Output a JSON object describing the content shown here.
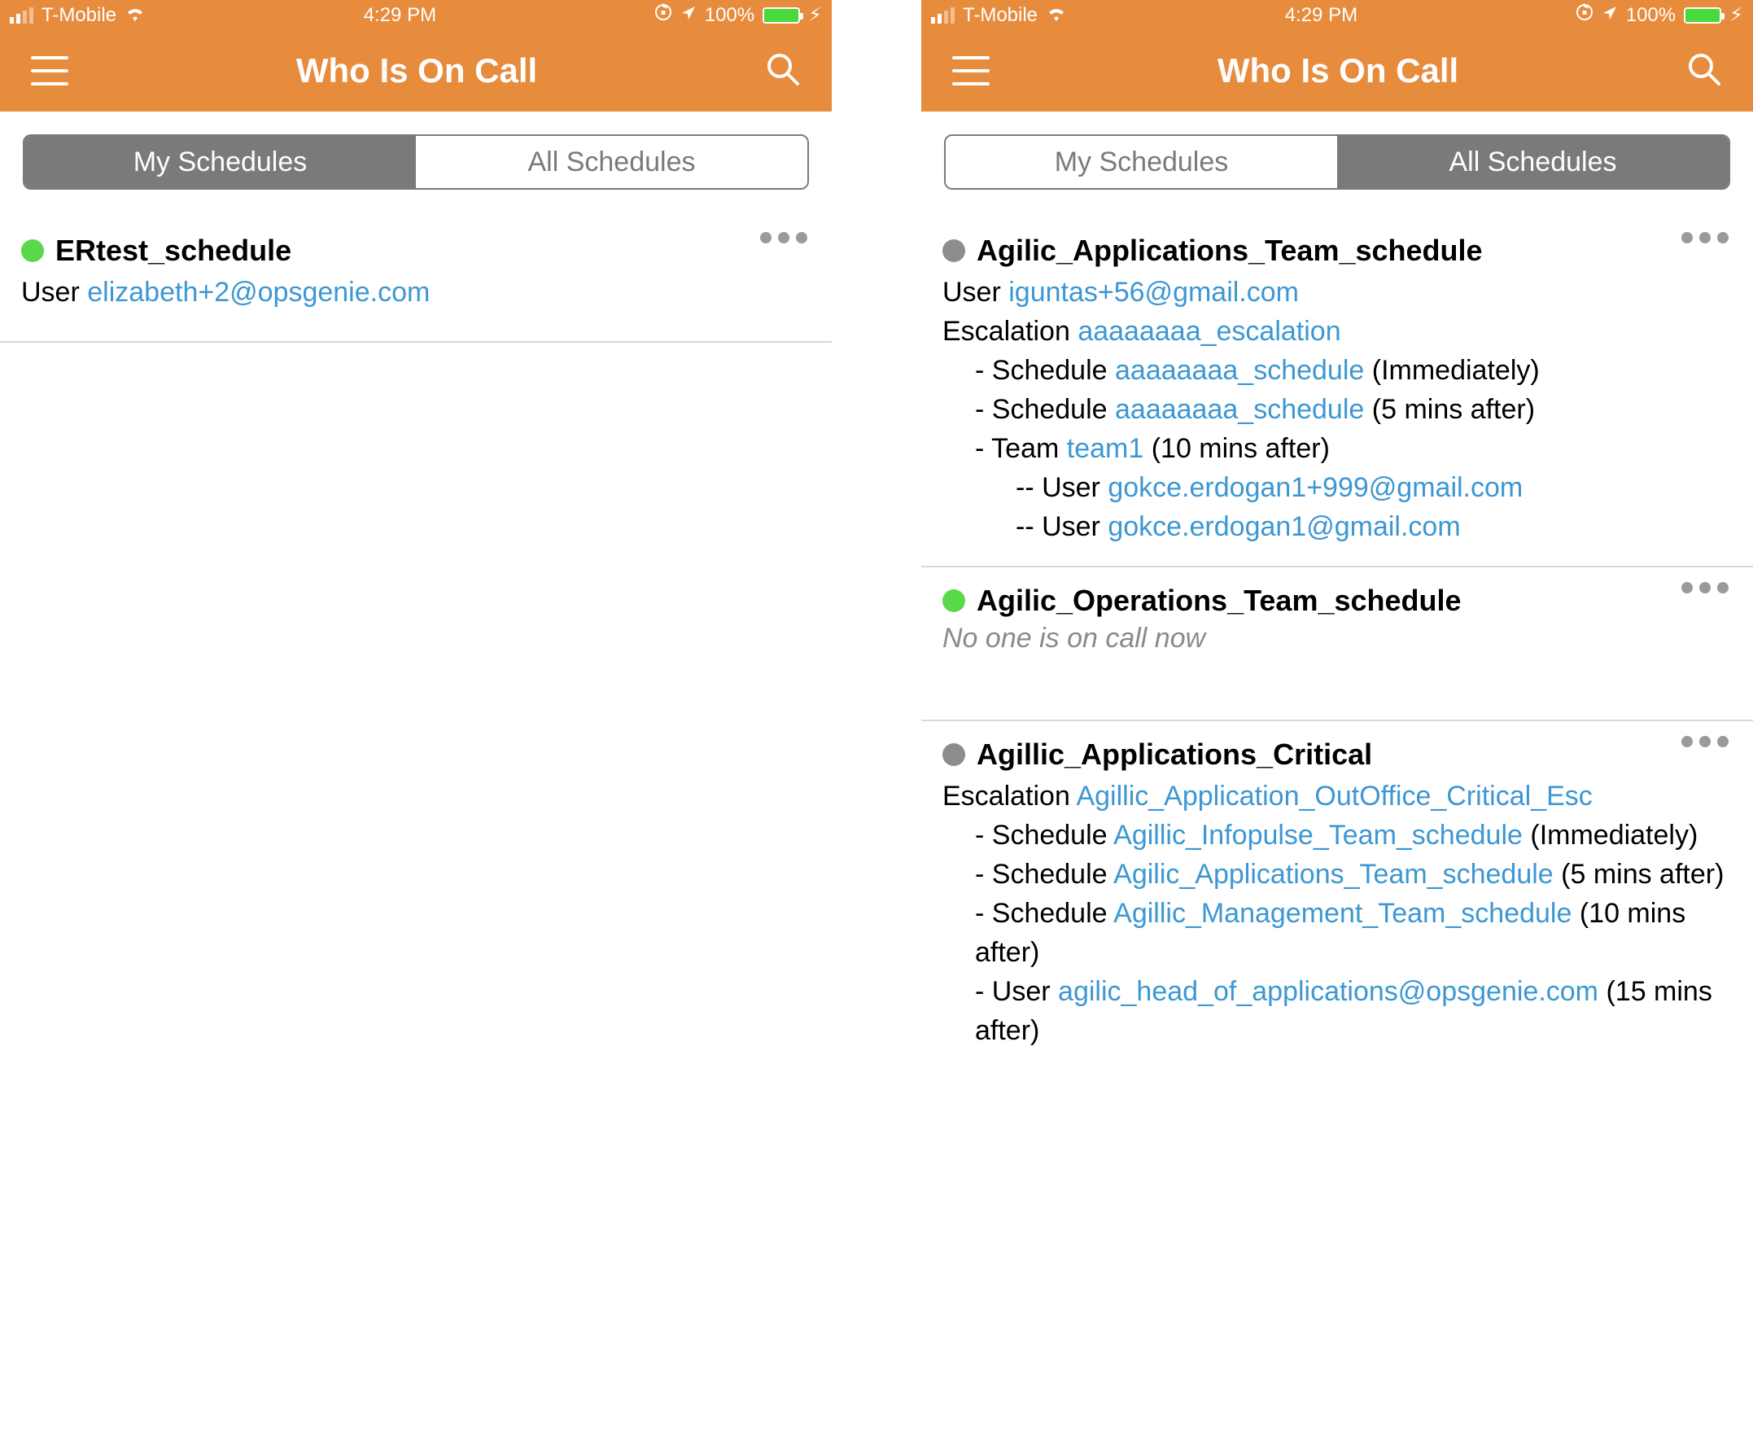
{
  "status": {
    "carrier": "T-Mobile",
    "time": "4:29 PM",
    "battery": "100%",
    "bolt": "⚡︎"
  },
  "nav": {
    "title": "Who Is On Call"
  },
  "tabs": {
    "my": "My Schedules",
    "all": "All Schedules"
  },
  "labels": {
    "user": "User",
    "escalation": "Escalation",
    "schedule": "Schedule",
    "team": "Team",
    "immediately": "Immediately",
    "five_after": "5 mins after",
    "ten_after": "10 mins after",
    "fifteen_after": "15 mins after",
    "no_one": "No one is on call now"
  },
  "left": {
    "items": [
      {
        "title": "ERtest_schedule",
        "user_email": "elizabeth+2@opsgenie.com"
      }
    ]
  },
  "right": {
    "items": [
      {
        "title": "Agilic_Applications_Team_schedule",
        "user_email": "iguntas+56@gmail.com",
        "escalation_name": "aaaaaaaa_escalation",
        "sched1": "aaaaaaaa_schedule",
        "sched2": "aaaaaaaa_schedule",
        "team_name": "team1",
        "team_user1": "gokce.erdogan1+999@gmail.com",
        "team_user2": "gokce.erdogan1@gmail.com"
      },
      {
        "title": "Agilic_Operations_Team_schedule"
      },
      {
        "title": "Agillic_Applications_Critical",
        "escalation_name": "Agillic_Application_OutOffice_Critical_Esc",
        "sched1": "Agillic_Infopulse_Team_schedule",
        "sched2": "Agilic_Applications_Team_schedule",
        "sched3": "Agillic_Management_Team_schedule",
        "user_email": "agilic_head_of_applications@opsgenie.com"
      }
    ]
  }
}
